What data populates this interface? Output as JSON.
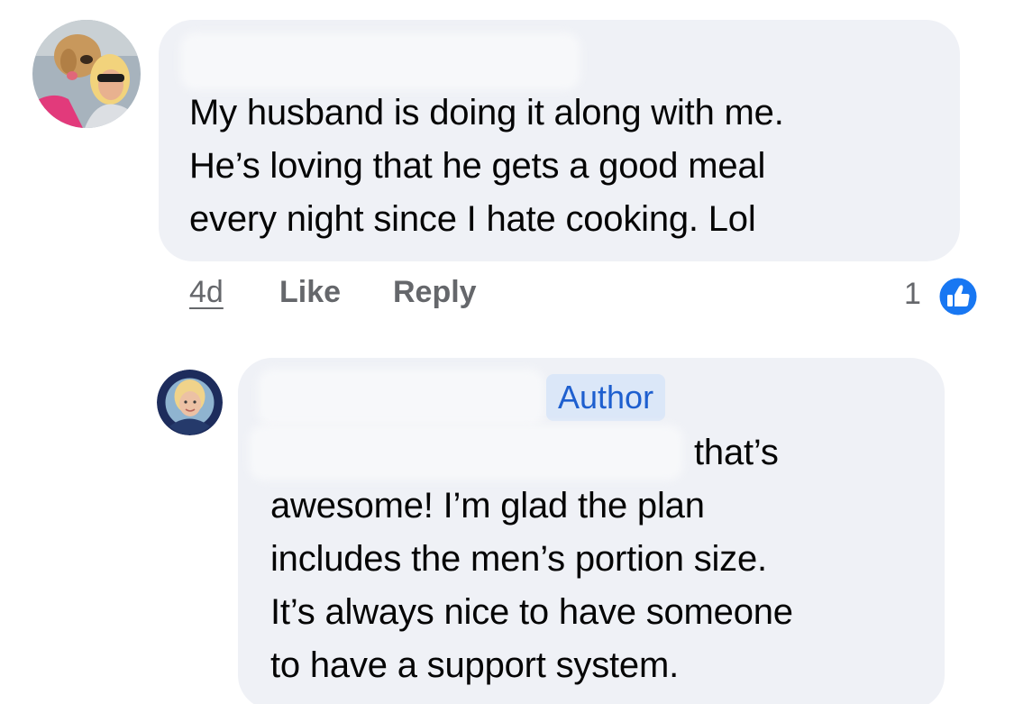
{
  "comments": [
    {
      "author_name": "",
      "lines": [
        "My husband is doing it along with me.",
        "He’s loving that he gets a good meal",
        "every night since I hate cooking. Lol"
      ],
      "actions": {
        "time": "4d",
        "like": "Like",
        "reply": "Reply"
      },
      "reactions": {
        "count": "1",
        "icon": "like-thumbs-up-icon",
        "color": "#1877f2"
      }
    }
  ],
  "reply": {
    "author_name": "",
    "badge": "Author",
    "lines": [
      "that’s",
      "awesome! I’m glad the plan",
      "includes the men’s portion size.",
      "It’s always nice to have someone",
      "to have a support system."
    ]
  },
  "colors": {
    "bubble": "#eff1f6",
    "badge_bg": "#dbe7f8",
    "badge_text": "#1e5fcf",
    "meta_text": "#65676b"
  }
}
